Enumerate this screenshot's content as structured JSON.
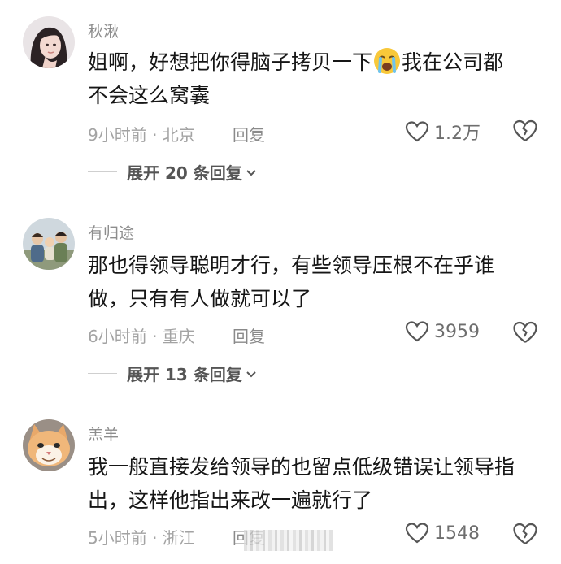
{
  "comments": [
    {
      "username": "秋湫",
      "text_before_emoji": "姐啊，好想把你得脑子拷贝一下",
      "emoji": "loudly-crying-face",
      "text_after_emoji": "我在公司都",
      "text_line2": "不会这么窝囊",
      "time_location": "9小时前 · 北京",
      "reply_label": "回复",
      "likes": "1.2万",
      "expand_label": "展开 20 条回复"
    },
    {
      "username": "有归途",
      "text_line1": "那也得领导聪明才行，有些领导压根不在乎谁",
      "text_line2": "做，只有有人做就可以了",
      "time_location": "6小时前 · 重庆",
      "reply_label": "回复",
      "likes": "3959",
      "expand_label": "展开 13 条回复"
    },
    {
      "username": "羔羊",
      "text_line1": "我一般直接发给领导的也留点低级错误让领导指",
      "text_line2": "出，这样他指出来改一遍就行了",
      "time_location": "5小时前 · 浙江",
      "reply_label": "回复",
      "likes": "1548"
    }
  ],
  "colors": {
    "username": "#8d8d8d",
    "text": "#161616",
    "meta": "#a3a3a3",
    "expand": "#555555"
  },
  "icons": [
    "heart-outline-icon",
    "broken-heart-icon",
    "chevron-down-icon",
    "loudly-crying-face-emoji"
  ]
}
